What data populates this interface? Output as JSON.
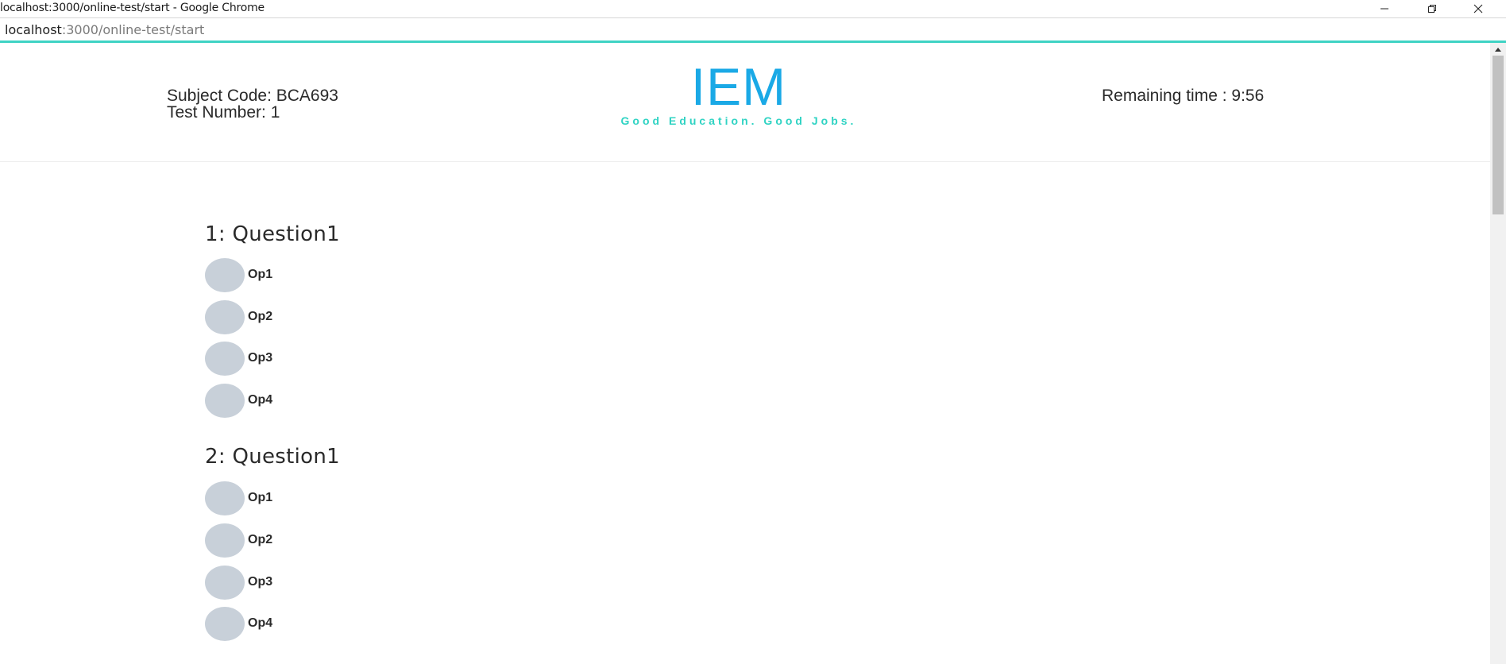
{
  "window": {
    "title": "localhost:3000/online-test/start - Google Chrome"
  },
  "address": {
    "host": "localhost",
    "path": ":3000/online-test/start"
  },
  "header": {
    "subject_code": "Subject Code: BCA693",
    "test_number": "Test Number: 1",
    "logo": "IEM",
    "tagline": "Good Education. Good Jobs.",
    "remaining_time": "Remaining time : 9:56"
  },
  "questions": [
    {
      "title": "1: Question1",
      "options": [
        "Op1",
        "Op2",
        "Op3",
        "Op4"
      ]
    },
    {
      "title": "2: Question1",
      "options": [
        "Op1",
        "Op2",
        "Op3",
        "Op4"
      ]
    }
  ],
  "colors": {
    "logo": "#1aa9e6",
    "tagline": "#2fd3c3",
    "progress_bar": "#3fd3c4",
    "radio_fill": "#c8d0d9"
  },
  "icons": {
    "minimize": "minimize-icon",
    "restore": "restore-icon",
    "close": "close-icon",
    "scroll_up": "chevron-up-icon"
  }
}
